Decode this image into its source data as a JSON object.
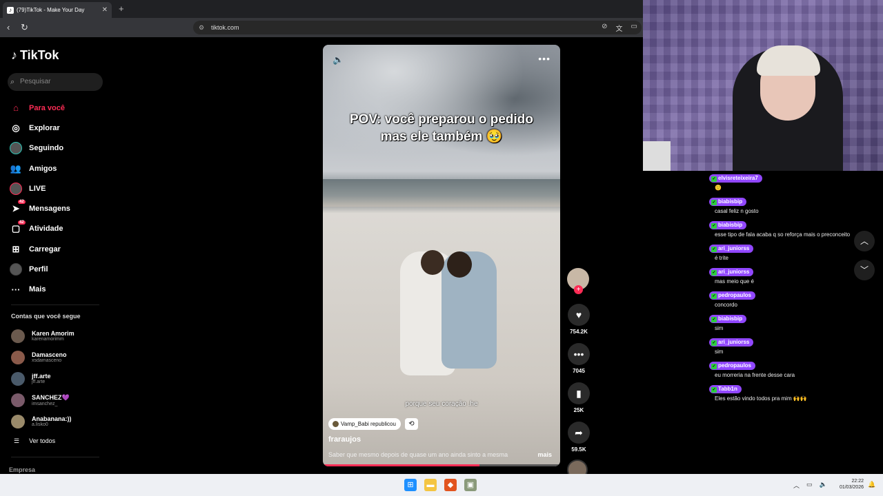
{
  "browser": {
    "tab_title": "(79)TikTok - Make Your Day",
    "tab_close": "✕",
    "new_tab": "+",
    "url": "tiktok.com"
  },
  "tiktok": {
    "logo_text": "TikTok",
    "search_placeholder": "Pesquisar",
    "menu": [
      {
        "label": "Para você",
        "icon": "home-icon",
        "active": true
      },
      {
        "label": "Explorar",
        "icon": "compass-icon"
      },
      {
        "label": "Seguindo",
        "icon": "following-avatar"
      },
      {
        "label": "Amigos",
        "icon": "friends-icon"
      },
      {
        "label": "LIVE",
        "icon": "live-avatar"
      },
      {
        "label": "Mensagens",
        "icon": "messages-icon",
        "badge": "42"
      },
      {
        "label": "Atividade",
        "icon": "activity-icon",
        "badge": "42"
      },
      {
        "label": "Carregar",
        "icon": "upload-icon"
      },
      {
        "label": "Perfil",
        "icon": "profile-avatar"
      },
      {
        "label": "Mais",
        "icon": "more-icon"
      }
    ],
    "follow_title": "Contas que você segue",
    "follows": [
      {
        "name": "Karen Amorim",
        "user": "karenamorimm"
      },
      {
        "name": "Damasceno",
        "user": "xsdamasceno"
      },
      {
        "name": "jff.arte",
        "user": "jff.arte"
      },
      {
        "name": "SANCHEZ💜",
        "user": "imsanchez_"
      },
      {
        "name": "Anabanana:))",
        "user": "a.lisko0"
      }
    ],
    "see_all": "Ver todos",
    "footer": "Empresa"
  },
  "video": {
    "caption_line1": "POV: você preparou o pedido",
    "caption_line2": "mas ele também 🥹",
    "subtitle": "porque seu coração .he",
    "repost_text": "Vamp_Babi republicou",
    "author": "fraraujos",
    "description": "Saber que mesmo depois de quase um ano ainda sinto a mesma",
    "more": "mais",
    "progress": 0.66
  },
  "actions": {
    "likes": "754.2K",
    "comments": "7045",
    "saves": "25K",
    "shares": "59.5K"
  },
  "chat": [
    {
      "user": "elvisreteixeira7",
      "text": "🙂"
    },
    {
      "user": "biabisbip",
      "text": "casal feliz n gosto"
    },
    {
      "user": "biabisbip",
      "text": "esse tipo de fala acaba q so reforça mais o preconceito"
    },
    {
      "user": "ari_juniorss",
      "text": "é trite"
    },
    {
      "user": "ari_juniorss",
      "text": "mas meio que é"
    },
    {
      "user": "pedropaulos",
      "text": "concordo"
    },
    {
      "user": "biabisbip",
      "text": "sim"
    },
    {
      "user": "ari_juniorss",
      "text": "sim"
    },
    {
      "user": "pedropaulos",
      "text": "eu morreria na frente desse cara"
    },
    {
      "user": "Tabb1n",
      "text": "Eles estão vindo todos pra mim 🙌🙌"
    }
  ],
  "taskbar": {
    "time": "22:22",
    "date": "01/03/2026"
  }
}
